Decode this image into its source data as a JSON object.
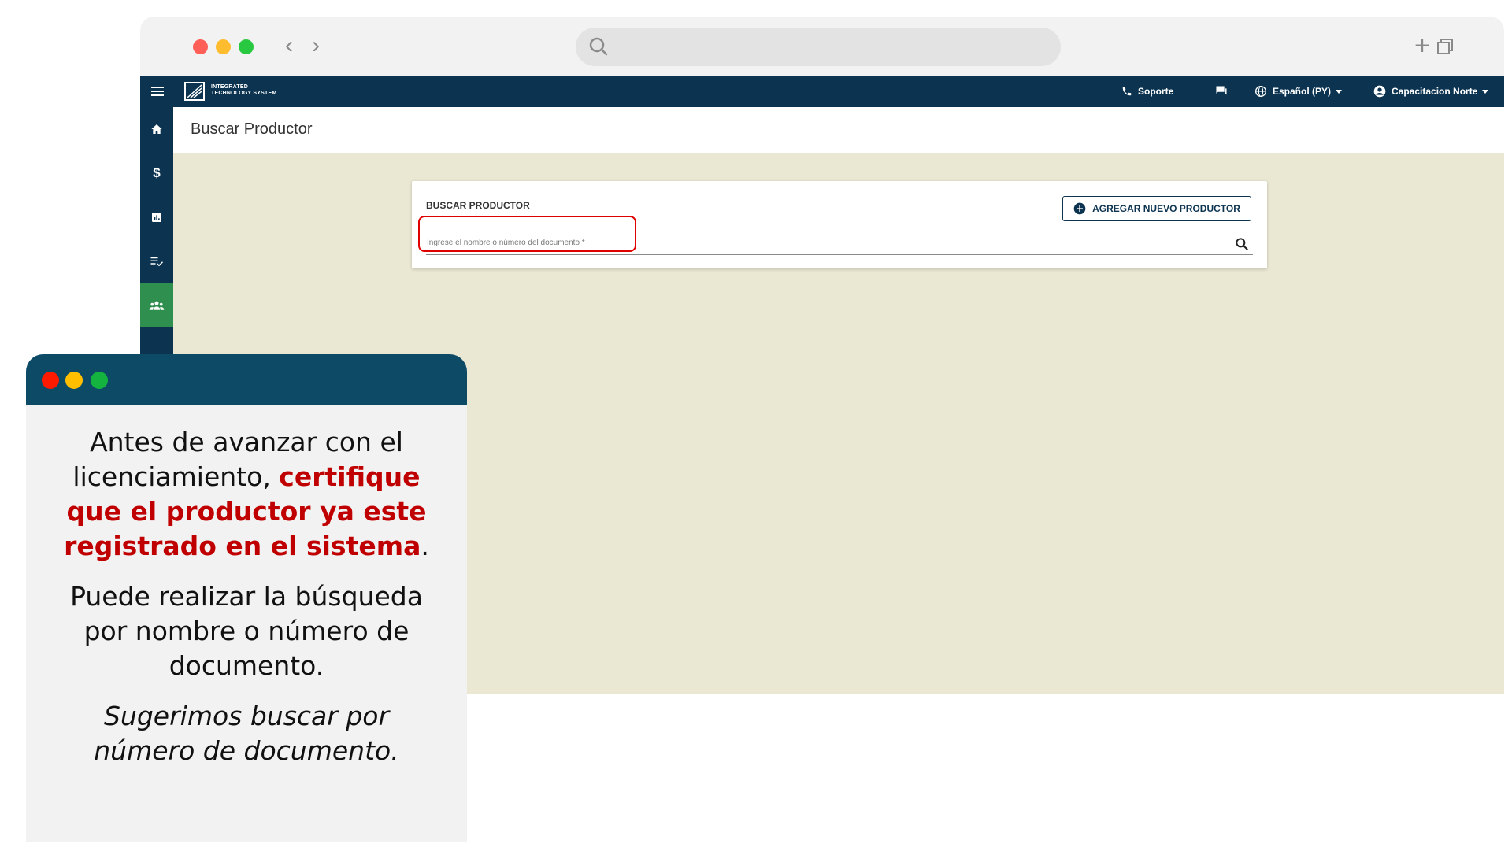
{
  "app": {
    "logo_line1": "INTEGRATED",
    "logo_line2": "TECHNOLOGY SYSTEM"
  },
  "header": {
    "support": "Soporte",
    "language": "Español (PY)",
    "user": "Capacitacion Norte"
  },
  "sidebar": {
    "items": [
      {
        "icon": "home-icon"
      },
      {
        "icon": "dollar-icon"
      },
      {
        "icon": "chart-icon"
      },
      {
        "icon": "checklist-icon"
      },
      {
        "icon": "people-icon",
        "active": true
      }
    ]
  },
  "page": {
    "title": "Buscar Productor"
  },
  "card": {
    "title": "BUSCAR PRODUCTOR",
    "add_button": "AGREGAR NUEVO PRODUCTOR",
    "search_placeholder": "Ingrese el nombre o número del documento *"
  },
  "panel": {
    "p1_a": "Antes de avanzar con el licenciamiento, ",
    "p1_b": "certifique que el productor ya este registrado en el sistema",
    "p1_c": ".",
    "p2": "Puede realizar la búsqueda por nombre o número de documento.",
    "p3": "Sugerimos buscar por número de documento."
  },
  "colors": {
    "header_bg": "#0c3451",
    "active_sidebar": "#2f8f4e",
    "content_bg": "#eae7d3",
    "highlight_red": "#e00000",
    "panel_emphasis": "#c00000"
  }
}
